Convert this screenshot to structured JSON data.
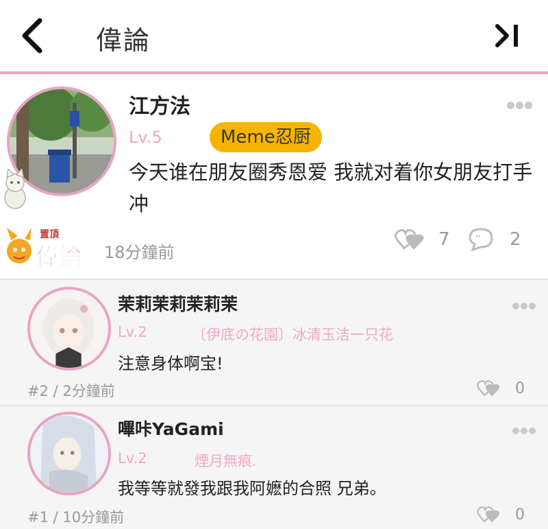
{
  "header": {
    "title": "偉論"
  },
  "post": {
    "username": "江方法",
    "level": "Lv.5",
    "badge": "Meme忍厨",
    "content": "今天谁在朋友圈秀恩爱 我就对着你女朋友打手冲",
    "time": "18分鐘前",
    "likes": "7",
    "comments": "2",
    "pin_logo": {
      "top_text": "置頂",
      "main_text": "偉論"
    }
  },
  "replies": [
    {
      "username": "茉莉茉莉茉莉茉",
      "level": "Lv.2",
      "title_tag": "〔伊底の花園〕冰清玉洁一只花",
      "text": "注意身体啊宝!",
      "meta": "#2 / 2分鐘前",
      "likes": "0"
    },
    {
      "username": "嗶咔YaGami",
      "level": "Lv.2",
      "title_tag": "煙月無痕.",
      "text": "我等等就發我跟我阿嬷的合照 兄弟。",
      "meta": "#1 / 10分鐘前",
      "likes": "0"
    }
  ],
  "colors": {
    "accent_pink": "#e8a3c2",
    "badge_yellow": "#f6b400",
    "level_pink": "#f0a7c4"
  },
  "icons": [
    "back-arrow-icon",
    "skip-to-last-icon",
    "more-dots-icon",
    "heart-like-icon",
    "comment-bubble-icon",
    "cat-sticker-icon"
  ]
}
